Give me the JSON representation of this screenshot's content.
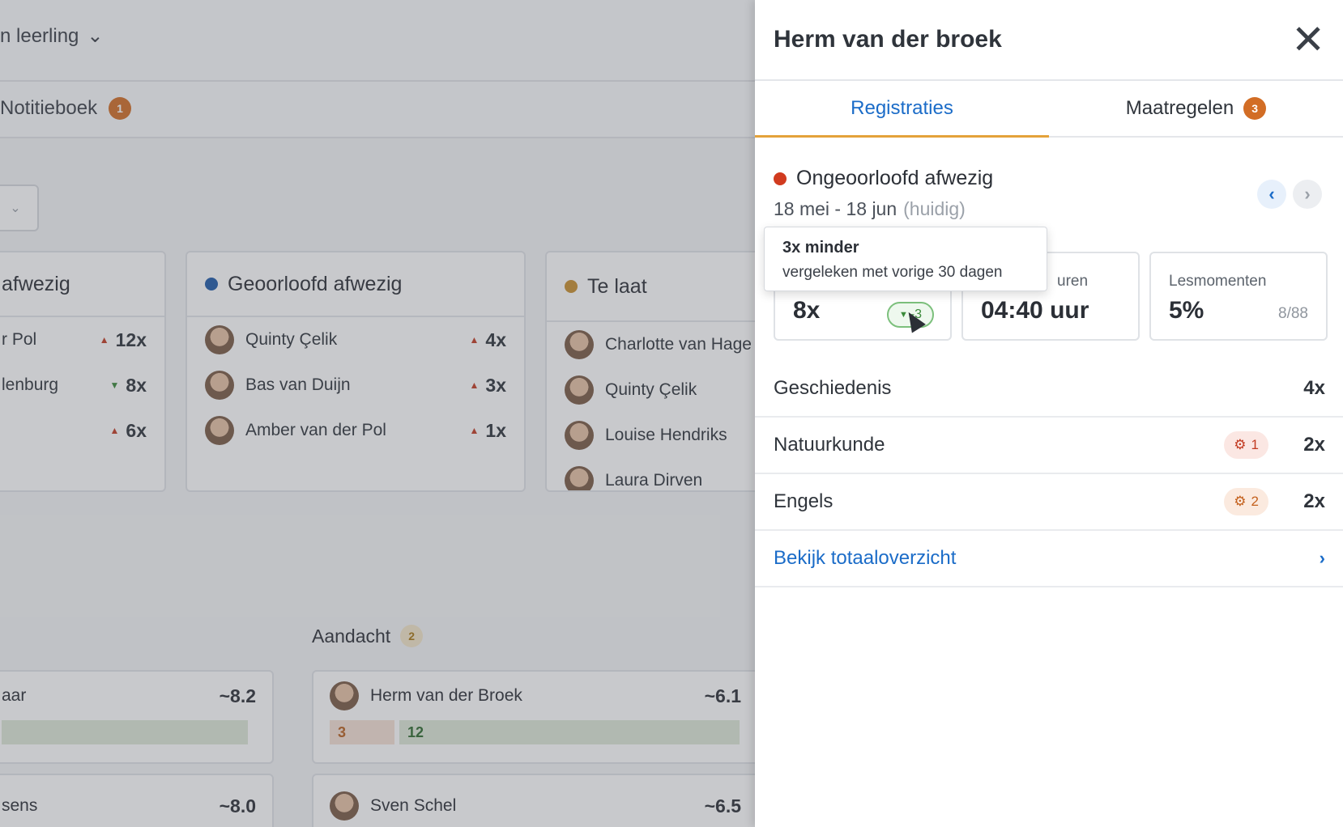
{
  "background": {
    "leerling_label": "n leerling",
    "notitieboek_label": "Notitieboek",
    "notitieboek_badge": "1",
    "cards": [
      {
        "title": "afwezig",
        "dot_color": "",
        "rows": [
          {
            "name": "r Pol",
            "trend": "up",
            "count": "12x"
          },
          {
            "name": "lenburg",
            "trend": "down",
            "count": "8x"
          },
          {
            "name": "",
            "trend": "up",
            "count": "6x"
          }
        ]
      },
      {
        "title": "Geoorloofd afwezig",
        "dot_color": "#1f5aa8",
        "rows": [
          {
            "name": "Quinty Çelik",
            "trend": "up",
            "count": "4x"
          },
          {
            "name": "Bas van Duijn",
            "trend": "up",
            "count": "3x"
          },
          {
            "name": "Amber van der Pol",
            "trend": "up",
            "count": "1x"
          }
        ]
      },
      {
        "title": "Te laat",
        "dot_color": "#c9902e",
        "rows": [
          {
            "name": "Charlotte van Hage",
            "trend": "",
            "count": ""
          },
          {
            "name": "Quinty Çelik",
            "trend": "",
            "count": ""
          },
          {
            "name": "Louise Hendriks",
            "trend": "",
            "count": ""
          },
          {
            "name": "Laura Dirven",
            "trend": "",
            "count": ""
          }
        ]
      }
    ],
    "aandacht_label": "Aandacht",
    "aandacht_badge": "2",
    "score_cards": [
      {
        "name": "aar",
        "score": "~8.2",
        "bars": []
      },
      {
        "name": "Herm van der Broek",
        "score": "~6.1",
        "bars": [
          "3",
          "12"
        ]
      },
      {
        "name": "sens",
        "score": "~8.0",
        "bars": []
      },
      {
        "name": "Sven Schel",
        "score": "~6.5",
        "bars": []
      }
    ]
  },
  "panel": {
    "title": "Herm van der broek",
    "tabs": [
      {
        "label": "Registraties",
        "badge": ""
      },
      {
        "label": "Maatregelen",
        "badge": "3"
      }
    ],
    "registration": {
      "title": "Ongeoorloofd afwezig",
      "dot_color": "#d13b1f",
      "date_range": "18 mei - 18 jun",
      "date_hint": "(huidig)"
    },
    "stats": [
      {
        "label": "",
        "value": "8x",
        "delta": "-3",
        "delta_direction": "down"
      },
      {
        "label": "uren",
        "value": "04:40 uur"
      },
      {
        "label": "Lesmomenten",
        "value": "5%",
        "sub": "8/88"
      }
    ],
    "tooltip": {
      "title": "3x minder",
      "text": "vergeleken met vorige 30 dagen"
    },
    "subjects": [
      {
        "name": "Geschiedenis",
        "count": "4x",
        "measure": ""
      },
      {
        "name": "Natuurkunde",
        "count": "2x",
        "measure": "1",
        "measure_color": "#c23b22"
      },
      {
        "name": "Engels",
        "count": "2x",
        "measure": "2",
        "measure_color": "#c4611d"
      }
    ],
    "overview_link": "Bekijk totaaloverzicht"
  }
}
